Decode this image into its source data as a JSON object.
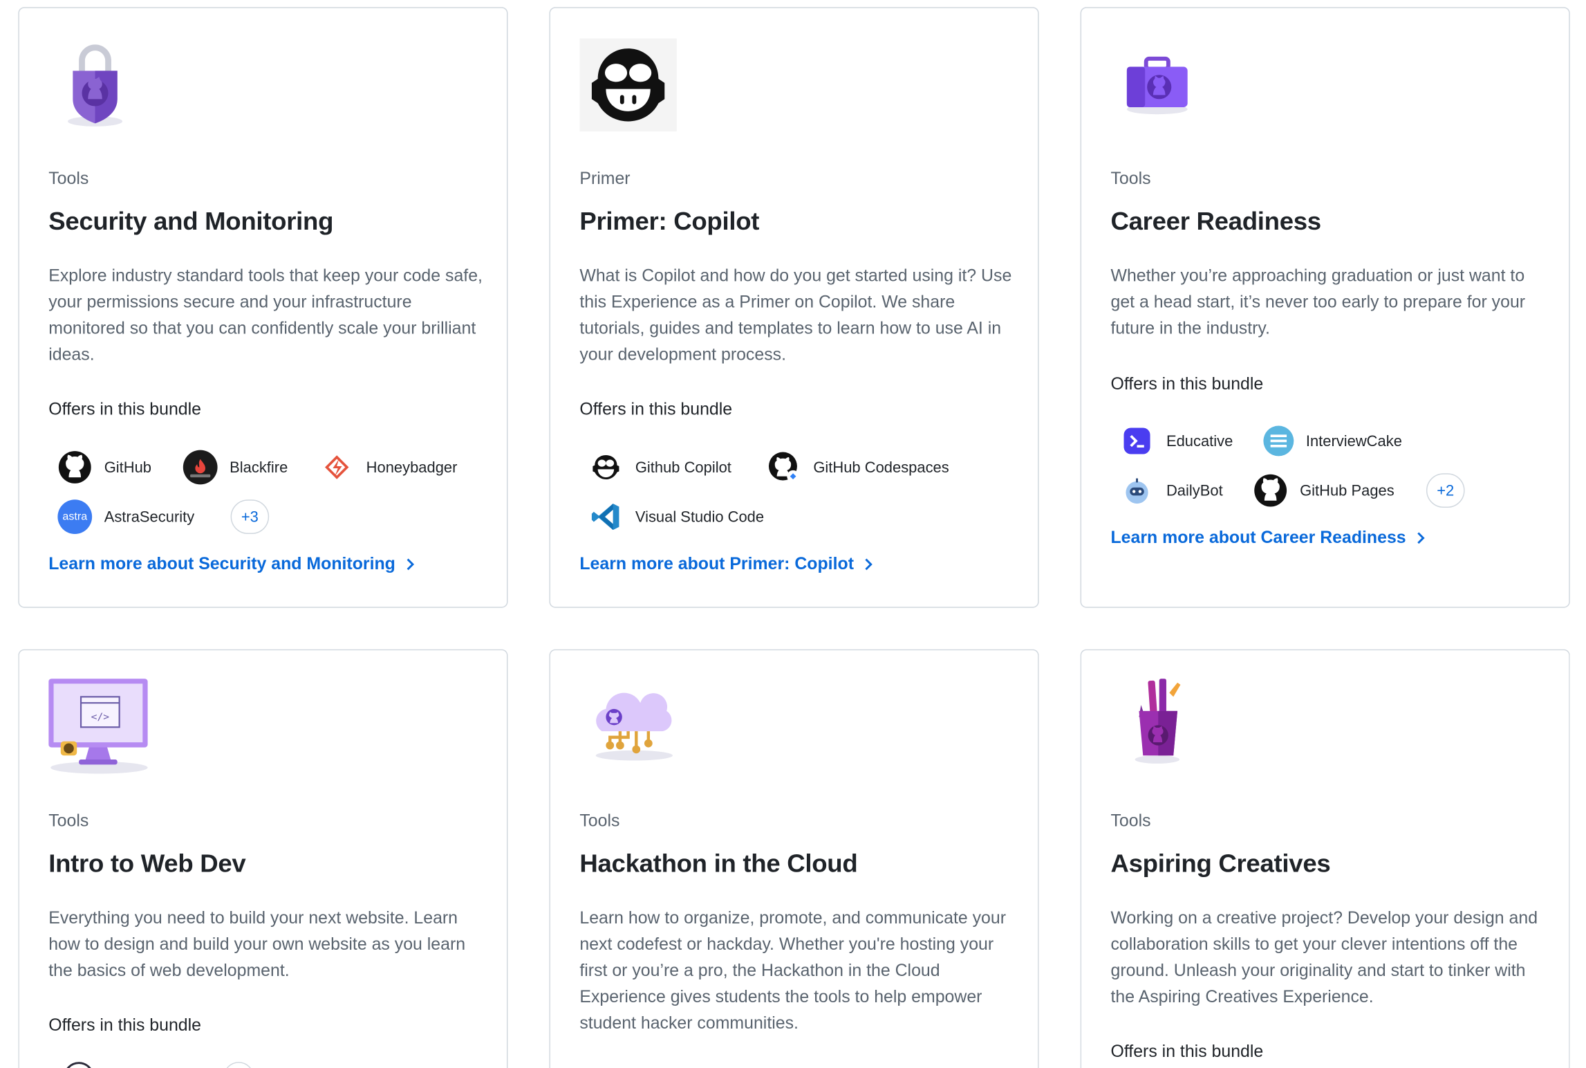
{
  "cards": [
    {
      "category": "Tools",
      "title": "Security and Monitoring",
      "description": "Explore industry standard tools that keep your code safe, your permissions secure and your infrastructure monitored so that you can confidently scale your brilliant ideas.",
      "offers_label": "Offers in this bundle",
      "offers": [
        "GitHub",
        "Blackfire",
        "Honeybadger",
        "AstraSecurity"
      ],
      "more": "+3",
      "learn_more": "Learn more about Security and Monitoring"
    },
    {
      "category": "Primer",
      "title": "Primer: Copilot",
      "description": "What is Copilot and how do you get started using it? Use this Experience as a Primer on Copilot. We share tutorials, guides and templates to learn how to use AI in your development process.",
      "offers_label": "Offers in this bundle",
      "offers": [
        "Github Copilot",
        "GitHub Codespaces",
        "Visual Studio Code"
      ],
      "learn_more": "Learn more about Primer: Copilot"
    },
    {
      "category": "Tools",
      "title": "Career Readiness",
      "description": "Whether you’re approaching graduation or just want to get a head start, it’s never too early to prepare for your future in the industry.",
      "offers_label": "Offers in this bundle",
      "offers": [
        "Educative",
        "InterviewCake",
        "DailyBot",
        "GitHub Pages"
      ],
      "more": "+2",
      "learn_more": "Learn more about Career Readiness"
    },
    {
      "category": "Tools",
      "title": "Intro to Web Dev",
      "description": "Everything you need to build your next website. Learn how to design and build your own website as you learn the basics of web development.",
      "offers_label": "Offers in this bundle"
    },
    {
      "category": "Tools",
      "title": "Hackathon in the Cloud",
      "description": "Learn how to organize, promote, and communicate your next codefest or hackday. Whether you're hosting your first or you’re a pro, the Hackathon in the Cloud Experience gives students the tools to help empower student hacker communities."
    },
    {
      "category": "Tools",
      "title": "Aspiring Creatives",
      "description": "Working on a creative project? Develop your design and collaboration skills to get your clever intentions off the ground. Unleash your originality and start to tinker with the Aspiring Creatives Experience.",
      "offers_label": "Offers in this bundle"
    }
  ],
  "icons": {
    "card_illustrations": [
      "padlock-shield-octocat",
      "copilot-mascot",
      "purple-briefcase-octocat",
      "monitor-code-window",
      "cloud-circuit-octocat",
      "pencil-cup-octocat"
    ],
    "chevron": "chevron-right-icon"
  },
  "colors": {
    "link": "#0969da",
    "muted_text": "#59636e",
    "border": "#d0d7de",
    "heading": "#1f2328",
    "illustration_purple": "#8a5cf6"
  }
}
